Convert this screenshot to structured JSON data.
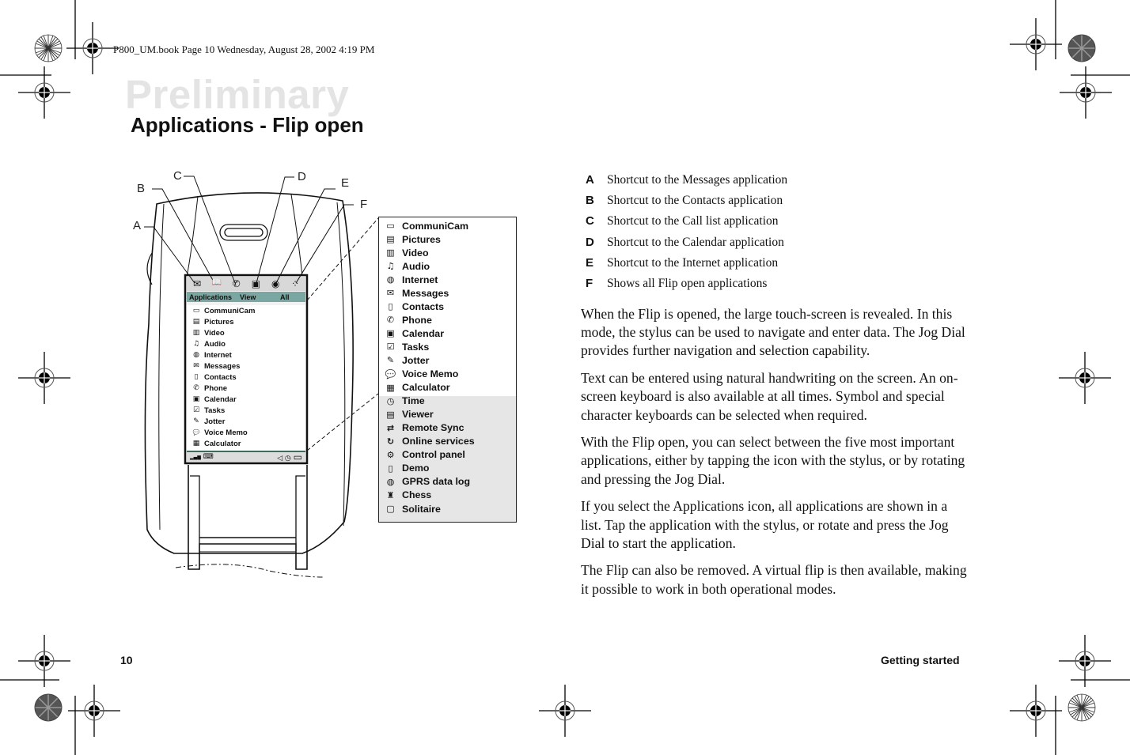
{
  "book_header": "P800_UM.book  Page 10  Wednesday, August 28, 2002  4:19 PM",
  "watermark": "Preliminary",
  "page_title": "Applications - Flip open",
  "figure": {
    "callout_labels": [
      "A",
      "B",
      "C",
      "D",
      "E",
      "F"
    ],
    "phone_screen": {
      "shortcut_icons": [
        {
          "icon": "envelope-icon",
          "glyph": "✉"
        },
        {
          "icon": "book-icon",
          "glyph": "📖"
        },
        {
          "icon": "phone-handset-icon",
          "glyph": "✆"
        },
        {
          "icon": "calendar-icon",
          "glyph": "▣"
        },
        {
          "icon": "globe-search-icon",
          "glyph": "◉"
        },
        {
          "icon": "apps-grid-icon",
          "glyph": "⁘"
        }
      ],
      "header": {
        "applications": "Applications",
        "view": "View",
        "all": "All"
      },
      "apps": [
        {
          "label": "CommuniCam",
          "icon": "camera-icon",
          "glyph": "▭"
        },
        {
          "label": "Pictures",
          "icon": "pictures-icon",
          "glyph": "▤"
        },
        {
          "label": "Video",
          "icon": "video-icon",
          "glyph": "▥"
        },
        {
          "label": "Audio",
          "icon": "music-note-icon",
          "glyph": "♫"
        },
        {
          "label": "Internet",
          "icon": "globe-search-icon",
          "glyph": "◍"
        },
        {
          "label": "Messages",
          "icon": "envelope-icon",
          "glyph": "✉"
        },
        {
          "label": "Contacts",
          "icon": "book-icon",
          "glyph": "▯"
        },
        {
          "label": "Phone",
          "icon": "phone-handset-icon",
          "glyph": "✆"
        },
        {
          "label": "Calendar",
          "icon": "calendar-icon",
          "glyph": "▣"
        },
        {
          "label": "Tasks",
          "icon": "checkbox-icon",
          "glyph": "☑"
        },
        {
          "label": "Jotter",
          "icon": "notepad-pen-icon",
          "glyph": "✎"
        },
        {
          "label": "Voice Memo",
          "icon": "speech-bubble-icon",
          "glyph": "💬"
        },
        {
          "label": "Calculator",
          "icon": "calculator-icon",
          "glyph": "▦"
        }
      ],
      "status_bar": {
        "left": [
          {
            "icon": "signal-icon",
            "glyph": "▂▄▆"
          },
          {
            "icon": "keyboard-icon",
            "glyph": "⌨"
          }
        ],
        "right": [
          {
            "icon": "speaker-icon",
            "glyph": "◁"
          },
          {
            "icon": "clock-icon",
            "glyph": "◷"
          },
          {
            "icon": "battery-icon",
            "glyph": "▭"
          }
        ]
      }
    },
    "full_app_list": [
      {
        "label": "CommuniCam",
        "icon": "camera-icon",
        "glyph": "▭"
      },
      {
        "label": "Pictures",
        "icon": "pictures-icon",
        "glyph": "▤"
      },
      {
        "label": "Video",
        "icon": "video-icon",
        "glyph": "▥"
      },
      {
        "label": "Audio",
        "icon": "music-note-icon",
        "glyph": "♫"
      },
      {
        "label": "Internet",
        "icon": "globe-search-icon",
        "glyph": "◍"
      },
      {
        "label": "Messages",
        "icon": "envelope-icon",
        "glyph": "✉"
      },
      {
        "label": "Contacts",
        "icon": "book-icon",
        "glyph": "▯"
      },
      {
        "label": "Phone",
        "icon": "phone-handset-icon",
        "glyph": "✆"
      },
      {
        "label": "Calendar",
        "icon": "calendar-icon",
        "glyph": "▣"
      },
      {
        "label": "Tasks",
        "icon": "checkbox-icon",
        "glyph": "☑"
      },
      {
        "label": "Jotter",
        "icon": "notepad-pen-icon",
        "glyph": "✎"
      },
      {
        "label": "Voice Memo",
        "icon": "speech-bubble-icon",
        "glyph": "💬"
      },
      {
        "label": "Calculator",
        "icon": "calculator-icon",
        "glyph": "▦"
      },
      {
        "label": "Time",
        "icon": "clock-icon",
        "glyph": "◷"
      },
      {
        "label": "Viewer",
        "icon": "document-viewer-icon",
        "glyph": "▤"
      },
      {
        "label": "Remote Sync",
        "icon": "sync-icon",
        "glyph": "⇄"
      },
      {
        "label": "Online services",
        "icon": "online-services-icon",
        "glyph": "↻"
      },
      {
        "label": "Control panel",
        "icon": "control-panel-icon",
        "glyph": "⚙"
      },
      {
        "label": "Demo",
        "icon": "demo-icon",
        "glyph": "▯"
      },
      {
        "label": "GPRS data log",
        "icon": "gprs-log-icon",
        "glyph": "◍"
      },
      {
        "label": "Chess",
        "icon": "chess-icon",
        "glyph": "♜"
      },
      {
        "label": "Solitaire",
        "icon": "cards-icon",
        "glyph": "▢"
      }
    ]
  },
  "callouts": [
    {
      "letter": "A",
      "text": "Shortcut to the Messages application"
    },
    {
      "letter": "B",
      "text": "Shortcut to the Contacts application"
    },
    {
      "letter": "C",
      "text": "Shortcut to the Call list application"
    },
    {
      "letter": "D",
      "text": "Shortcut to the Calendar application"
    },
    {
      "letter": "E",
      "text": "Shortcut to the Internet application"
    },
    {
      "letter": "F",
      "text": "Shows all Flip open applications"
    }
  ],
  "paragraphs": [
    "When the Flip is opened, the large touch-screen is revealed. In this mode, the stylus can be used to navigate and enter data. The Jog Dial provides further navigation and selection capability.",
    "Text can be entered using natural handwriting on the screen. An on-screen keyboard is also available at all times. Symbol and special character keyboards can be selected when required.",
    "With the Flip open, you can select between the five most important applications, either by tapping the icon with the stylus, or by rotating and pressing the Jog Dial.",
    "If you select the Applications icon, all applications are shown in a list. Tap the application with the stylus, or rotate and press the Jog Dial to start the application.",
    "The Flip can also be removed. A virtual flip is then available, making it possible to work in both operational modes."
  ],
  "footer": {
    "page_number": "10",
    "section": "Getting started"
  },
  "colors": {
    "screen_header": "#7aa7a2",
    "watermark": "#e4e4e4",
    "list_grey": "#e6e6e6"
  }
}
